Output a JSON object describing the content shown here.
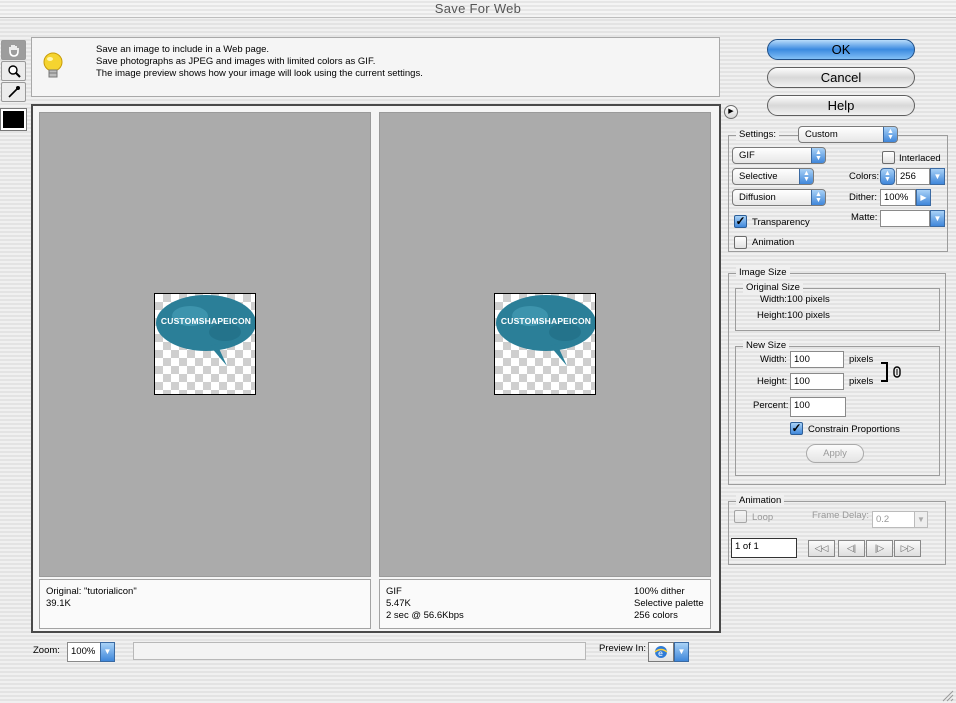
{
  "window": {
    "title": "Save For Web"
  },
  "info": {
    "lines": [
      "Save an image to include in a Web page.",
      "Save photographs as JPEG and images with limited colors as GIF.",
      "The image preview shows how your image will look using the current settings."
    ]
  },
  "buttons": {
    "ok": "OK",
    "cancel": "Cancel",
    "help": "Help"
  },
  "preview": {
    "original": {
      "name": "Original: \"tutorialicon\"",
      "size": "39.1K"
    },
    "optimized": {
      "format": "GIF",
      "size": "5.47K",
      "time": "2 sec @ 56.6Kbps",
      "dither": "100% dither",
      "palette": "Selective palette",
      "colors": "256 colors"
    },
    "thumb_text": "CUSTOMSHAPEICON"
  },
  "settings": {
    "label": "Settings:",
    "preset": "Custom",
    "format": "GIF",
    "reduction": "Selective",
    "dither_algo": "Diffusion",
    "interlaced_label": "Interlaced",
    "interlaced": false,
    "colors_label": "Colors:",
    "colors": "256",
    "dither_label": "Dither:",
    "dither": "100%",
    "transparency_label": "Transparency",
    "transparency": true,
    "matte_label": "Matte:",
    "matte": "",
    "animation_label": "Animation",
    "animation": false
  },
  "image_size": {
    "title": "Image Size",
    "original_title": "Original Size",
    "orig_width": "Width:100 pixels",
    "orig_height": "Height:100 pixels",
    "new_title": "New Size",
    "width_label": "Width:",
    "width": "100",
    "height_label": "Height:",
    "height": "100",
    "pixels": "pixels",
    "percent_label": "Percent:",
    "percent": "100",
    "constrain_label": "Constrain Proportions",
    "constrain": true,
    "apply": "Apply"
  },
  "animation": {
    "title": "Animation",
    "loop_label": "Loop",
    "loop": false,
    "frame_delay_label": "Frame Delay:",
    "frame_delay": "0.2",
    "frame_counter": "1 of 1",
    "nav": [
      "◁◁",
      "◁|",
      "|▷",
      "▷▷"
    ]
  },
  "bottom": {
    "zoom_label": "Zoom:",
    "zoom": "100%",
    "status": "",
    "preview_in_label": "Preview In:"
  },
  "colors": {
    "accent": "#3f87da",
    "pane_gray": "#ababab",
    "bubble": "#2b7f98"
  }
}
